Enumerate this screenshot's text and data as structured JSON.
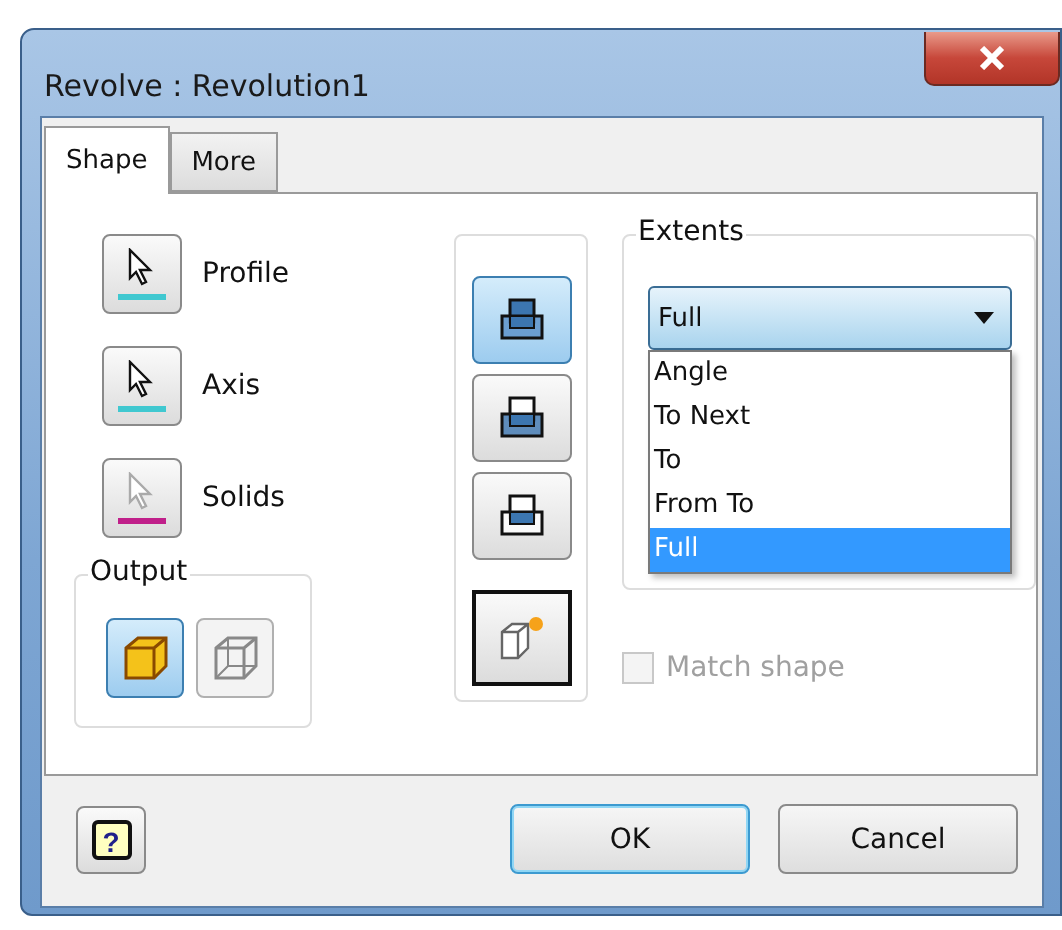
{
  "window": {
    "title": "Revolve : Revolution1"
  },
  "tabs": [
    {
      "label": "Shape",
      "selected": true
    },
    {
      "label": "More",
      "selected": false
    }
  ],
  "selectors": [
    {
      "label": "Profile",
      "color": "#40c8d0",
      "disabled": false
    },
    {
      "label": "Axis",
      "color": "#40c8d0",
      "disabled": false
    },
    {
      "label": "Solids",
      "color": "#c0208a",
      "disabled": true
    }
  ],
  "output": {
    "title": "Output",
    "buttons": [
      {
        "kind": "solid",
        "selected": true
      },
      {
        "kind": "surface",
        "selected": false
      }
    ]
  },
  "direction_buttons": [
    {
      "kind": "default",
      "selected": true
    },
    {
      "kind": "flipped",
      "selected": false
    },
    {
      "kind": "symmetric",
      "selected": false
    }
  ],
  "extents": {
    "title": "Extents",
    "value": "Full",
    "expanded": true,
    "options": [
      {
        "label": "Angle",
        "selected": false
      },
      {
        "label": "To Next",
        "selected": false
      },
      {
        "label": "To",
        "selected": false
      },
      {
        "label": "From To",
        "selected": false
      },
      {
        "label": "Full",
        "selected": true
      }
    ]
  },
  "match_shape": {
    "label": "Match shape",
    "checked": false,
    "disabled": true
  },
  "help_button": {
    "glyph": "?"
  },
  "buttons": [
    {
      "label": "OK",
      "default": true
    },
    {
      "label": "Cancel",
      "default": false
    }
  ]
}
